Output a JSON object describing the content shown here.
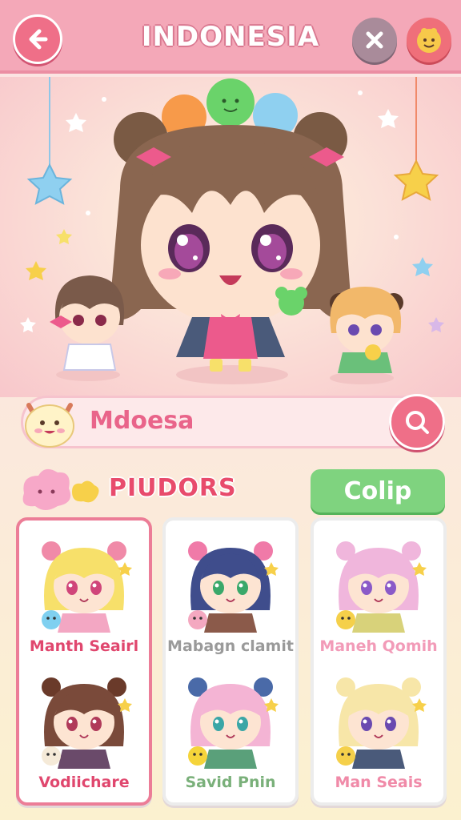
{
  "header": {
    "title": "INDONESIA",
    "back_icon": "arrow-left-icon",
    "close_icon": "close-icon",
    "profile_icon": "smiley-face-icon"
  },
  "search": {
    "value": "Mdoesa",
    "icon": "search-icon"
  },
  "section": {
    "title": "PIUDORS",
    "button_label": "Colip"
  },
  "grid": [
    {
      "name": "Manth Seairl",
      "hair": "#f7e06a",
      "outfit": "#f3a7c3",
      "eyes": "#d0457a",
      "name_color": "#e0476e",
      "pet": "#7fd0f0",
      "ears": "#f08aa8"
    },
    {
      "name": "Mabagn clamit",
      "hair": "#3f4d8c",
      "outfit": "#8b5a4a",
      "eyes": "#3aa86a",
      "name_color": "#9a9a9a",
      "pet": "#f4a8c0",
      "ears": "#f07aa8"
    },
    {
      "name": "Maneh Qomih",
      "hair": "#f0b6dc",
      "outfit": "#d8d27a",
      "eyes": "#8a5ac8",
      "name_color": "#f29bb8",
      "pet": "#f5d04a",
      "ears": "#f0b6dc"
    },
    {
      "name": "Vodiichare",
      "hair": "#7a4a3a",
      "outfit": "#6a4a6a",
      "eyes": "#b03a5a",
      "name_color": "#e0476e",
      "pet": "#f5ead8",
      "ears": "#6a3a2a"
    },
    {
      "name": "Savid Pnin",
      "hair": "#f4b4d4",
      "outfit": "#5aa07a",
      "eyes": "#3aa6a6",
      "name_color": "#7ab07a",
      "pet": "#f5d43a",
      "ears": "#4a6aa8"
    },
    {
      "name": "Man Seais",
      "hair": "#f7e6a8",
      "outfit": "#4a5a7a",
      "eyes": "#6a4ab0",
      "name_color": "#f08aa8",
      "pet": "#f5d04a",
      "ears": "#f7e6a8"
    }
  ],
  "colors": {
    "accent": "#ef6f88",
    "header_bg": "#f4a8b8",
    "button_green": "#7fd37f",
    "selected_border": "#ec7d97"
  }
}
